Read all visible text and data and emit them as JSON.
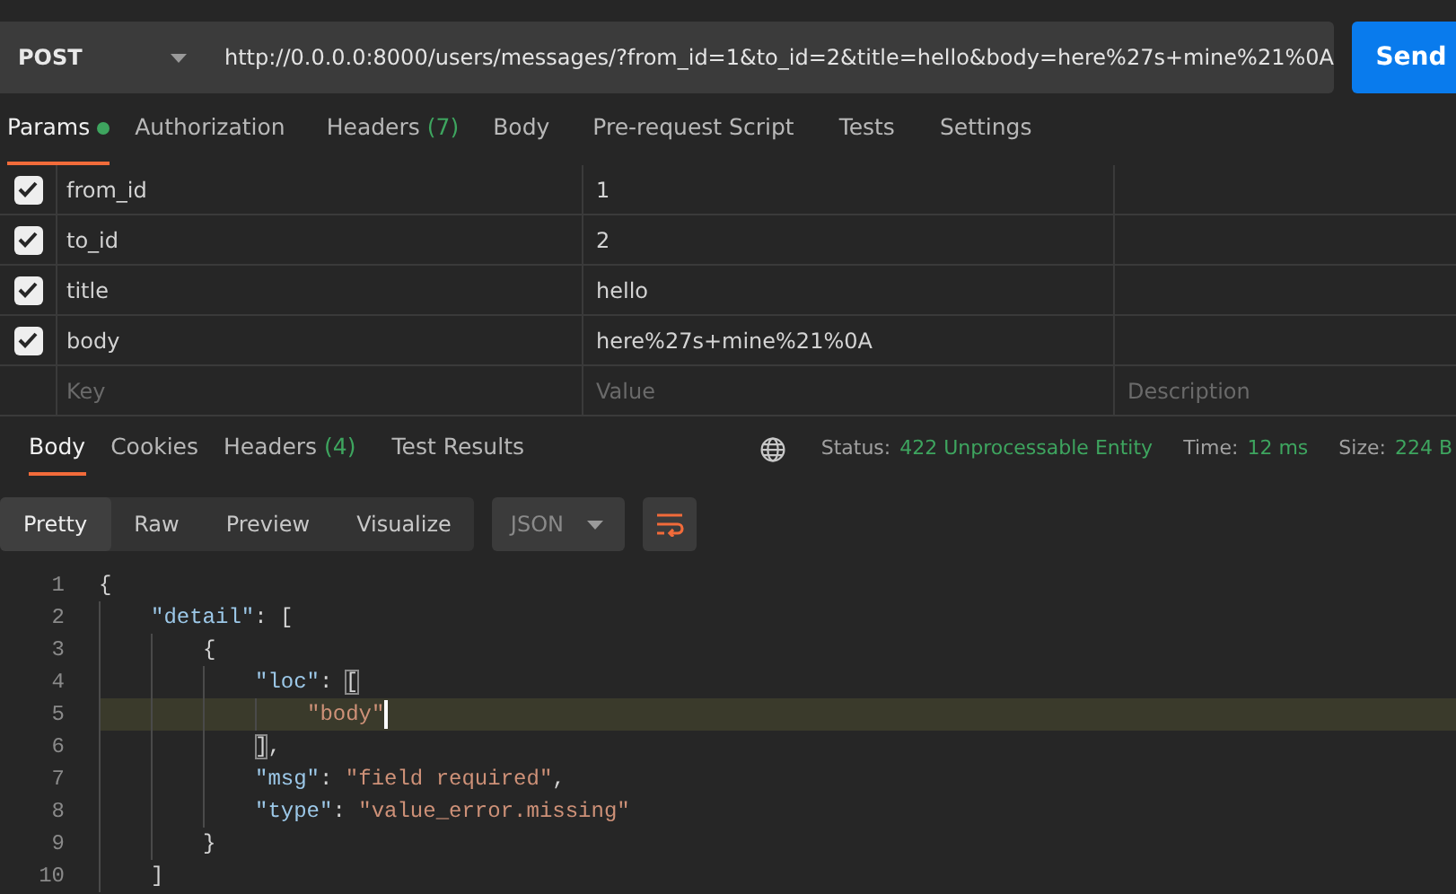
{
  "request": {
    "method": "POST",
    "url": "http://0.0.0.0:8000/users/messages/?from_id=1&to_id=2&title=hello&body=here%27s+mine%21%0A",
    "send": "Send"
  },
  "request_tabs": [
    {
      "label": "Params",
      "selected": true,
      "indicator": true
    },
    {
      "label": "Authorization",
      "selected": false,
      "indicator": false
    },
    {
      "label": "Headers",
      "count": "(7)",
      "selected": false,
      "indicator": false
    },
    {
      "label": "Body",
      "selected": false,
      "indicator": false
    },
    {
      "label": "Pre-request Script",
      "selected": false,
      "indicator": false
    },
    {
      "label": "Tests",
      "selected": false,
      "indicator": false
    },
    {
      "label": "Settings",
      "selected": false,
      "indicator": false
    }
  ],
  "params": {
    "rows": [
      {
        "checked": true,
        "key": "from_id",
        "value": "1"
      },
      {
        "checked": true,
        "key": "to_id",
        "value": "2"
      },
      {
        "checked": true,
        "key": "title",
        "value": "hello"
      },
      {
        "checked": true,
        "key": "body",
        "value": "here%27s+mine%21%0A"
      }
    ],
    "new_row": {
      "key": {
        "placeholder": "Key"
      },
      "value": {
        "placeholder": "Value"
      },
      "description": {
        "placeholder": "Description"
      }
    }
  },
  "response_tabs": [
    {
      "label": "Body",
      "selected": true
    },
    {
      "label": "Cookies",
      "selected": false
    },
    {
      "label": "Headers",
      "count": "(4)",
      "selected": false
    },
    {
      "label": "Test Results",
      "selected": false
    }
  ],
  "status": {
    "status_label": "Status:",
    "status": "422 Unprocessable Entity",
    "time_label": "Time:",
    "time": "12 ms",
    "size_label": "Size:",
    "size": "224 B"
  },
  "view_modes": [
    {
      "label": "Pretty",
      "selected": true
    },
    {
      "label": "Raw",
      "selected": false
    },
    {
      "label": "Preview",
      "selected": false
    },
    {
      "label": "Visualize",
      "selected": false
    }
  ],
  "format": "JSON",
  "code_lines": [
    {
      "number": "1",
      "highlighted": false,
      "cursor": false,
      "tokens": [
        {
          "kind": "open",
          "text": "{"
        }
      ]
    },
    {
      "number": "2",
      "highlighted": false,
      "cursor": false,
      "tokens": [
        {
          "kind": "key",
          "text": "\"detail\""
        },
        {
          "kind": "punct",
          "text": ": "
        },
        {
          "kind": "open",
          "text": "["
        }
      ]
    },
    {
      "number": "3",
      "highlighted": false,
      "cursor": false,
      "tokens": [
        {
          "kind": "open",
          "text": "{"
        }
      ]
    },
    {
      "number": "4",
      "highlighted": false,
      "cursor": false,
      "tokens": [
        {
          "kind": "key",
          "text": "\"loc\""
        },
        {
          "kind": "punct",
          "text": ": "
        },
        {
          "kind": "open",
          "text": "[",
          "matched": true
        }
      ]
    },
    {
      "number": "5",
      "highlighted": true,
      "cursor": true,
      "tokens": [
        {
          "kind": "string",
          "text": "\"body\""
        }
      ]
    },
    {
      "number": "6",
      "highlighted": false,
      "cursor": false,
      "tokens": [
        {
          "kind": "close",
          "text": "]",
          "matched": true
        },
        {
          "kind": "punct",
          "text": ","
        }
      ]
    },
    {
      "number": "7",
      "highlighted": false,
      "cursor": false,
      "tokens": [
        {
          "kind": "key",
          "text": "\"msg\""
        },
        {
          "kind": "punct",
          "text": ": "
        },
        {
          "kind": "string",
          "text": "\"field required\""
        },
        {
          "kind": "punct",
          "text": ","
        }
      ]
    },
    {
      "number": "8",
      "highlighted": false,
      "cursor": false,
      "tokens": [
        {
          "kind": "key",
          "text": "\"type\""
        },
        {
          "kind": "punct",
          "text": ": "
        },
        {
          "kind": "string",
          "text": "\"value_error.missing\""
        }
      ]
    },
    {
      "number": "9",
      "highlighted": false,
      "cursor": false,
      "tokens": [
        {
          "kind": "close",
          "text": "}"
        }
      ]
    },
    {
      "number": "10",
      "highlighted": false,
      "cursor": false,
      "tokens": [
        {
          "kind": "close",
          "text": "]"
        }
      ]
    }
  ]
}
